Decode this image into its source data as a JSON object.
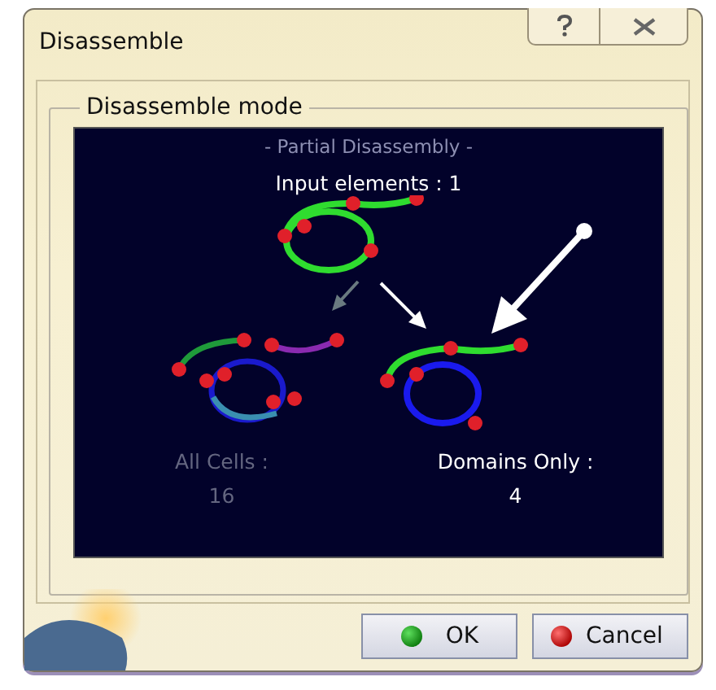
{
  "window": {
    "title": "Disassemble"
  },
  "group": {
    "label": "Disassemble mode",
    "panel": {
      "heading": "- Partial Disassembly -",
      "input": "Input elements : 1",
      "options": [
        {
          "label": "All Cells :",
          "count": "16",
          "selected": false
        },
        {
          "label": "Domains Only :",
          "count": "4",
          "selected": true
        }
      ]
    }
  },
  "buttons": [
    {
      "label": "OK",
      "kind": "ok"
    },
    {
      "label": "Cancel",
      "kind": "cancel"
    }
  ]
}
